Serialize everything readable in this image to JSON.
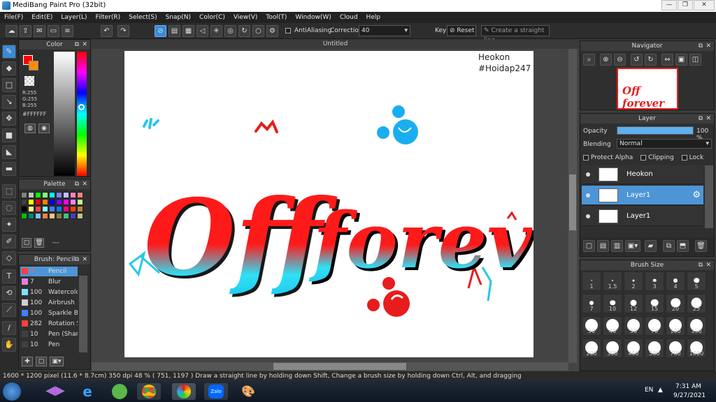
{
  "window": {
    "title": "MediBang Paint Pro (32bit)"
  },
  "menu": [
    "File(F)",
    "Edit(E)",
    "Layer(L)",
    "Filter(R)",
    "Select(S)",
    "Snap(N)",
    "Color(C)",
    "View(V)",
    "Tool(T)",
    "Window(W)",
    "Cloud",
    "Help"
  ],
  "toolbar": {
    "antialiasing": "AntiAliasing",
    "correction_label": "Correction",
    "correction_value": "40",
    "key_label": "Key",
    "reset_label": "Reset",
    "straight_line_placeholder": "Create a straight line"
  },
  "canvas": {
    "tab_title": "Untitled",
    "watermark_line1": "Heokon",
    "watermark_line2": "#Hoidap247",
    "art_text": "Off forever"
  },
  "color_panel": {
    "title": "Color",
    "r": "R:255",
    "g": "G:255",
    "b": "B:255",
    "hex": "#FFFFFF",
    "fg_color": "#ff0000",
    "bg_color": "#ffffff"
  },
  "palette_panel": {
    "title": "Palette",
    "swatches": [
      "#808080",
      "#c0c0c0",
      "#00ff00",
      "#80ff80",
      "#00ffff",
      "#8080ff",
      "#c0c0ff",
      "#ff80c0",
      "#ff8080",
      "#404040",
      "#ffff00",
      "#ff0000",
      "#ff8000",
      "#0000ff",
      "#8000ff",
      "#ff00ff",
      "#ff80ff",
      "#c0ff80",
      "#000000",
      "#ffff80",
      "#ff4040",
      "#80ffff",
      "#4080ff",
      "#0080ff",
      "#ff0080",
      "#ff4000",
      "#c08040",
      "#00c000",
      "#008080",
      "#80c0ff",
      "#ff8040",
      "#ffc080",
      "#808040",
      "#40c080",
      "#4040c0",
      "#c0c080"
    ],
    "extra": "---"
  },
  "brush_panel": {
    "title": "Brush: Pencil",
    "items": [
      {
        "size": "4",
        "name": "Pencil",
        "color": "#ff4040"
      },
      {
        "size": "7",
        "name": "Blur",
        "color": "#e080e0"
      },
      {
        "size": "100",
        "name": "Watercolor",
        "color": "#80e0ff"
      },
      {
        "size": "100",
        "name": "Airbrush",
        "color": "#d0d0d0"
      },
      {
        "size": "100",
        "name": "Sparkle Brush",
        "color": "#4080ff"
      },
      {
        "size": "282",
        "name": "Rotation S",
        "color": "#ff4040"
      },
      {
        "size": "10",
        "name": "Pen (Sharp)",
        "color": "#404040"
      },
      {
        "size": "10",
        "name": "Pen",
        "color": "#404040"
      }
    ]
  },
  "navigator": {
    "title": "Navigator"
  },
  "layer_panel": {
    "title": "Layer",
    "opacity_label": "Opacity",
    "opacity_value": "100 %",
    "opacity_fraction": 1.0,
    "blending_label": "Blending",
    "blending_value": "Normal",
    "protect_alpha": "Protect Alpha",
    "clipping": "Clipping",
    "lock": "Lock",
    "layers": [
      {
        "name": "Heokon",
        "selected": false
      },
      {
        "name": "Layer1",
        "selected": true
      },
      {
        "name": "Layer1",
        "selected": false
      }
    ]
  },
  "brushsize_panel": {
    "title": "Brush Size",
    "sizes": [
      "1",
      "1.5",
      "2",
      "3",
      "4",
      "5",
      "7",
      "10",
      "12",
      "15",
      "20",
      "25",
      "30",
      "40",
      "50",
      "70",
      "100",
      "150",
      "200",
      "300",
      "400",
      "500",
      "700",
      "1000"
    ]
  },
  "status": {
    "size": "1600 * 1200 pixel",
    "cm": "(11.6 * 8.7cm)",
    "dpi": "350 dpi",
    "zoom": "48 %",
    "coords": "( 751, 1197 )",
    "hint": "Draw a straight line by holding down Shift, Change a brush size by holding down Ctrl, Alt, and dragging"
  },
  "taskbar": {
    "lang": "EN",
    "time": "7:31 AM",
    "date": "9/27/2021",
    "zalo": "Zalo"
  }
}
